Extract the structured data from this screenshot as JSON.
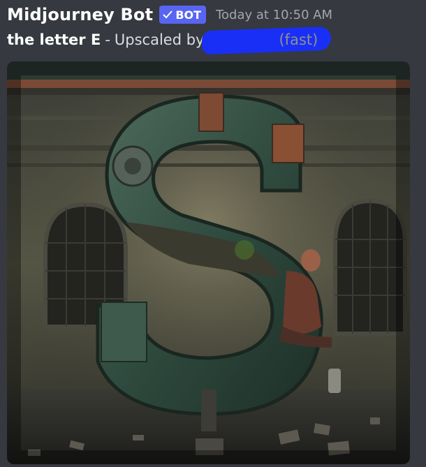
{
  "message": {
    "author": "Midjourney Bot",
    "bot_badge": "BOT",
    "timestamp": "Today at 10:50 AM",
    "prompt": "the letter E",
    "separator": "-",
    "action": "Upscaled by",
    "mode": "(fast)"
  },
  "icons": {
    "badge_check": "checkmark-icon"
  },
  "colors": {
    "background": "#36393f",
    "bot_badge": "#5865f2",
    "redaction": "#1a2ff5"
  }
}
